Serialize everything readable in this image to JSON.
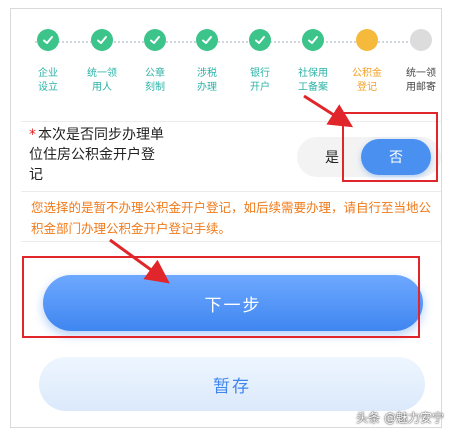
{
  "steps": [
    {
      "label": "企业\n设立",
      "status": "done"
    },
    {
      "label": "统一领\n用人",
      "status": "done"
    },
    {
      "label": "公章\n刻制",
      "status": "done"
    },
    {
      "label": "涉税\n办理",
      "status": "done"
    },
    {
      "label": "银行\n开户",
      "status": "done"
    },
    {
      "label": "社保用\n工备案",
      "status": "done"
    },
    {
      "label": "公积金\n登记",
      "status": "current"
    },
    {
      "label": "统一领\n用邮寄",
      "status": "pending"
    }
  ],
  "question": {
    "required_mark": "*",
    "text": "本次是否同步办理单位住房公积金开户登记",
    "yes_label": "是",
    "no_label": "否",
    "selected": "否"
  },
  "notice": "您选择的是暂不办理公积金开户登记，如后续需要办理，请自行至当地公积金部门办理公积金开户登记手续。",
  "buttons": {
    "next_label": "下一步",
    "save_label": "暂存"
  },
  "watermark": "头条 @魅力安宁",
  "colors": {
    "done": "#3dc48a",
    "current": "#f5b93c",
    "pending": "#dcdcdc",
    "primary": "#4a90f0",
    "notice": "#f07a1a",
    "highlight": "#e0262a"
  }
}
